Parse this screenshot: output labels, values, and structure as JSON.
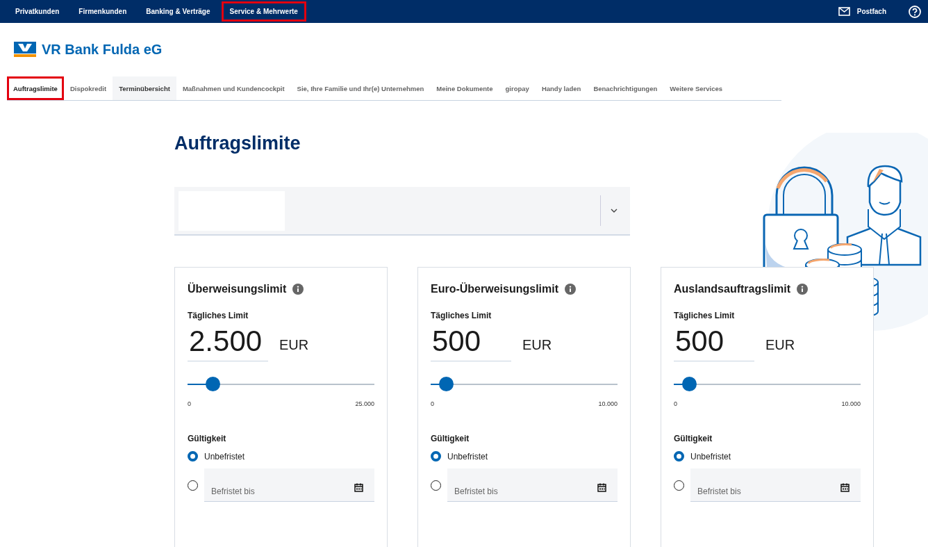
{
  "top_nav": {
    "items": [
      {
        "label": "Privatkunden",
        "highlighted": false
      },
      {
        "label": "Firmenkunden",
        "highlighted": false
      },
      {
        "label": "Banking & Verträge",
        "highlighted": false
      },
      {
        "label": "Service & Mehrwerte",
        "highlighted": true
      }
    ],
    "mailbox": "Postfach"
  },
  "brand": {
    "name": "VR Bank Fulda eG"
  },
  "tabs": [
    {
      "label": "Auftragslimite",
      "selected": true,
      "hovered": false,
      "highlighted": true
    },
    {
      "label": "Dispokredit",
      "selected": false,
      "hovered": false,
      "highlighted": false
    },
    {
      "label": "Terminübersicht",
      "selected": false,
      "hovered": true,
      "highlighted": false
    },
    {
      "label": "Maßnahmen und Kundencockpit",
      "selected": false,
      "hovered": false,
      "highlighted": false
    },
    {
      "label": "Sie, Ihre Familie und Ihr(e) Unternehmen",
      "selected": false,
      "hovered": false,
      "highlighted": false
    },
    {
      "label": "Meine Dokumente",
      "selected": false,
      "hovered": false,
      "highlighted": false
    },
    {
      "label": "giropay",
      "selected": false,
      "hovered": false,
      "highlighted": false
    },
    {
      "label": "Handy laden",
      "selected": false,
      "hovered": false,
      "highlighted": false
    },
    {
      "label": "Benachrichtigungen",
      "selected": false,
      "hovered": false,
      "highlighted": false
    },
    {
      "label": "Weitere Services",
      "selected": false,
      "hovered": false,
      "highlighted": false
    }
  ],
  "page": {
    "title": "Auftragslimite"
  },
  "limits": [
    {
      "title": "Überweisungslimit",
      "label": "Tägliches Limit",
      "amount": "2.500",
      "currency": "EUR",
      "level": 0.1,
      "min": "0",
      "max": "25.000",
      "validity_label": "Gültigkeit",
      "options": [
        {
          "kind": "radio",
          "label": "Unbefristet",
          "selected": true
        },
        {
          "kind": "date",
          "placeholder": "Befristet bis",
          "selected": false
        }
      ]
    },
    {
      "title": "Euro-Überweisungslimit",
      "label": "Tägliches Limit",
      "amount": "500",
      "currency": "EUR",
      "level": 0.05,
      "min": "0",
      "max": "10.000",
      "validity_label": "Gültigkeit",
      "options": [
        {
          "kind": "radio",
          "label": "Unbefristet",
          "selected": true
        },
        {
          "kind": "date",
          "placeholder": "Befristet bis",
          "selected": false
        }
      ]
    },
    {
      "title": "Auslandsauftragslimit",
      "label": "Tägliches Limit",
      "amount": "500",
      "currency": "EUR",
      "level": 0.05,
      "min": "0",
      "max": "10.000",
      "validity_label": "Gültigkeit",
      "options": [
        {
          "kind": "radio",
          "label": "Unbefristet",
          "selected": true
        },
        {
          "kind": "date",
          "placeholder": "Befristet bis",
          "selected": false
        }
      ]
    }
  ]
}
